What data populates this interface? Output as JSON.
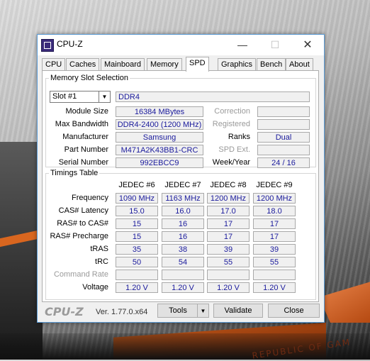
{
  "window": {
    "title": "CPU-Z"
  },
  "tabs": [
    "CPU",
    "Caches",
    "Mainboard",
    "Memory",
    "SPD",
    "Graphics",
    "Bench",
    "About"
  ],
  "active_tab": "SPD",
  "slot_section": {
    "title": "Memory Slot Selection",
    "slot_value": "Slot #1",
    "type": "DDR4",
    "module_size_label": "Module Size",
    "module_size": "16384 MBytes",
    "max_bandwidth_label": "Max Bandwidth",
    "max_bandwidth": "DDR4-2400 (1200 MHz)",
    "manufacturer_label": "Manufacturer",
    "manufacturer": "Samsung",
    "part_number_label": "Part Number",
    "part_number": "M471A2K43BB1-CRC",
    "serial_number_label": "Serial Number",
    "serial_number": "992EBCC9",
    "correction_label": "Correction",
    "registered_label": "Registered",
    "ranks_label": "Ranks",
    "ranks": "Dual",
    "spd_ext_label": "SPD Ext.",
    "week_year_label": "Week/Year",
    "week_year": "24 / 16"
  },
  "timings": {
    "title": "Timings Table",
    "headers": [
      "JEDEC #6",
      "JEDEC #7",
      "JEDEC #8",
      "JEDEC #9"
    ],
    "rows": [
      {
        "label": "Frequency",
        "values": [
          "1090 MHz",
          "1163 MHz",
          "1200 MHz",
          "1200 MHz"
        ],
        "grey": false
      },
      {
        "label": "CAS# Latency",
        "values": [
          "15.0",
          "16.0",
          "17.0",
          "18.0"
        ],
        "grey": false
      },
      {
        "label": "RAS# to CAS#",
        "values": [
          "15",
          "16",
          "17",
          "17"
        ],
        "grey": false
      },
      {
        "label": "RAS# Precharge",
        "values": [
          "15",
          "16",
          "17",
          "17"
        ],
        "grey": false
      },
      {
        "label": "tRAS",
        "values": [
          "35",
          "38",
          "39",
          "39"
        ],
        "grey": false
      },
      {
        "label": "tRC",
        "values": [
          "50",
          "54",
          "55",
          "55"
        ],
        "grey": false
      },
      {
        "label": "Command Rate",
        "values": [
          "",
          "",
          "",
          ""
        ],
        "grey": true
      },
      {
        "label": "Voltage",
        "values": [
          "1.20 V",
          "1.20 V",
          "1.20 V",
          "1.20 V"
        ],
        "grey": false
      }
    ]
  },
  "footer": {
    "logo": "CPU-Z",
    "version": "Ver. 1.77.0.x64",
    "tools_label": "Tools",
    "validate_label": "Validate",
    "close_label": "Close"
  },
  "wallpaper": {
    "text": "REPUBLIC OF GAM"
  },
  "colors": {
    "value_text": "#1a1a9c",
    "window_border": "#5b9bd5"
  }
}
